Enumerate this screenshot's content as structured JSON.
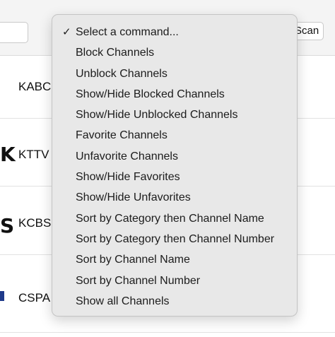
{
  "toolbar": {
    "search_value": "",
    "scan_label": "Scan"
  },
  "channels": [
    {
      "name": "KABC",
      "logo_fragment": ""
    },
    {
      "name": "KTTV",
      "logo_fragment": "K"
    },
    {
      "name": "KCBS",
      "logo_fragment": "S"
    },
    {
      "name": "CSPA",
      "logo_fragment": ""
    }
  ],
  "colors": {
    "logo_bar": "#1f3a8a"
  },
  "command_menu": {
    "selected_mark": "✓",
    "items": [
      "Select a command...",
      "Block Channels",
      "Unblock Channels",
      "Show/Hide Blocked Channels",
      "Show/Hide Unblocked Channels",
      "Favorite Channels",
      "Unfavorite Channels",
      "Show/Hide Favorites",
      "Show/Hide Unfavorites",
      "Sort by Category then Channel Name",
      "Sort by Category then Channel Number",
      "Sort by Channel Name",
      "Sort by Channel Number",
      "Show all Channels"
    ]
  }
}
